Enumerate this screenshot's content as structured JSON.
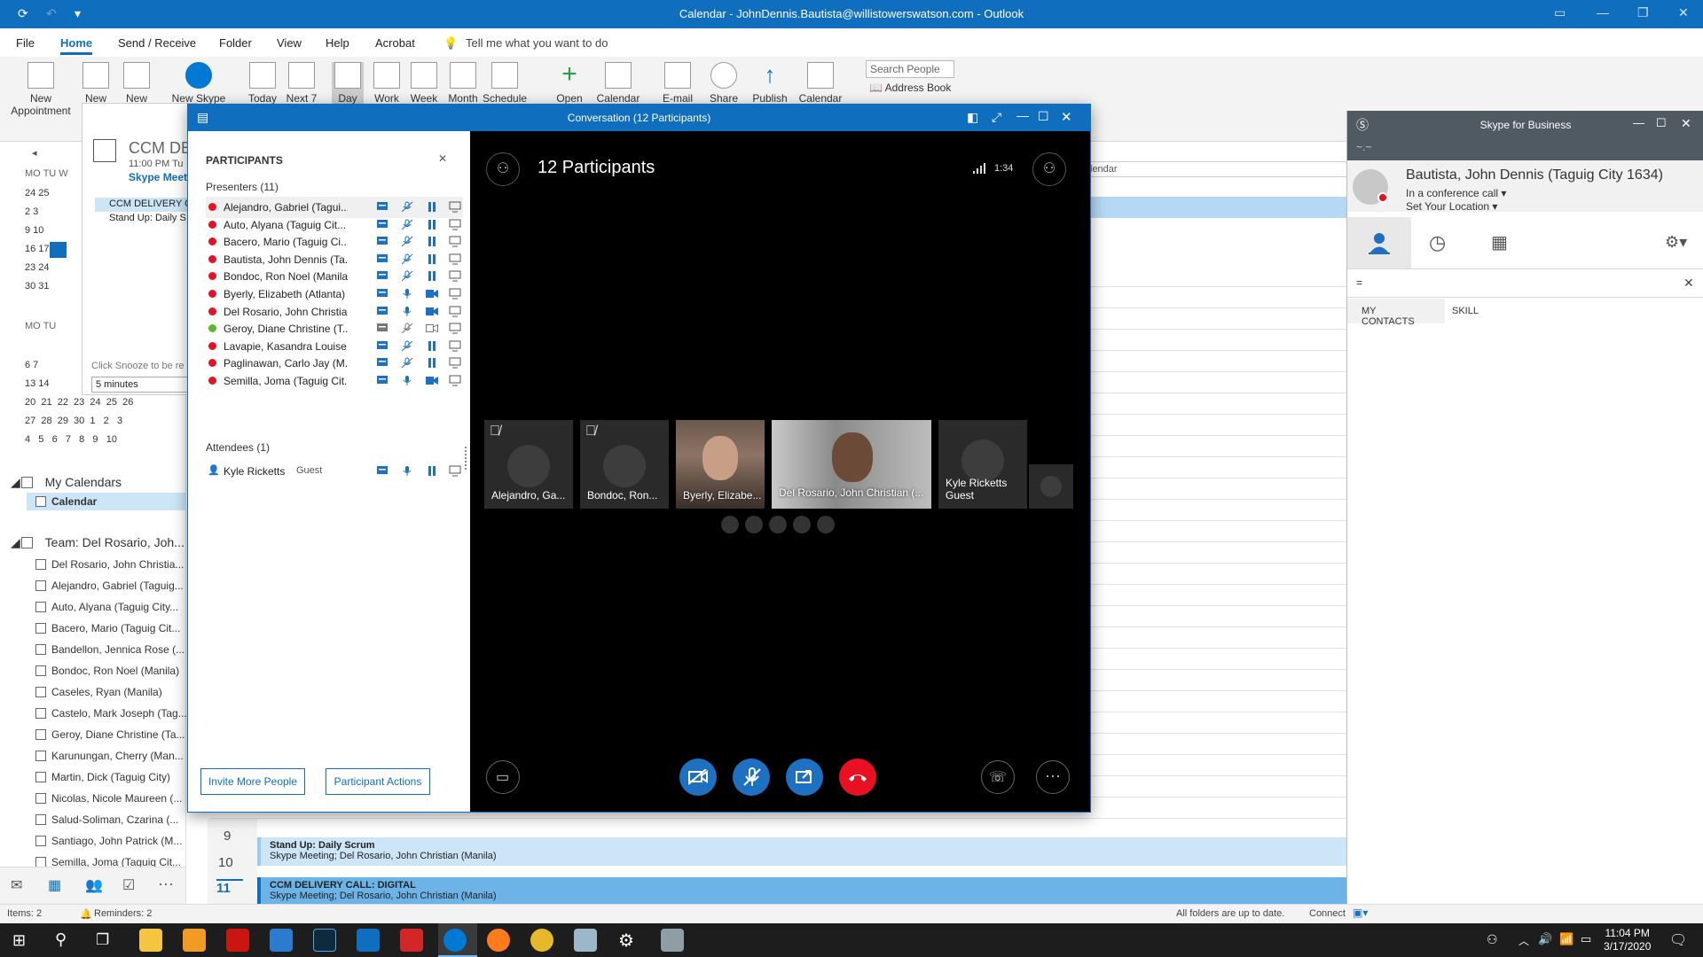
{
  "outlook": {
    "title": "Calendar - JohnDennis.Bautista@willistowerswatson.com  -  Outlook",
    "tabs": [
      "File",
      "Home",
      "Send / Receive",
      "Folder",
      "View",
      "Help",
      "Acrobat"
    ],
    "tell_me": "Tell me what you want to do",
    "ribbon": {
      "new_appointment": "New Appointment",
      "new_meeting": "New",
      "new_items": "New",
      "new_skype": "New Skype",
      "today": "Today",
      "next7": "Next 7",
      "day": "Day",
      "work": "Work",
      "week": "Week",
      "month": "Month",
      "schedule": "Schedule",
      "open": "Open",
      "calendar": "Calendar",
      "email": "E-mail",
      "share": "Share",
      "publish": "Publish",
      "calendar2": "Calendar",
      "search_people": "Search People",
      "address_book": "Address Book"
    },
    "mini_cal": {
      "days_header": "MO  TU  W",
      "rows1": [
        "24  25",
        "2   3",
        "9   10",
        "16  17",
        "23  24",
        "30  31"
      ],
      "days_header2": "MO  TU",
      "rows2": [
        "6   7",
        "13  14",
        "20  21  22  23  24  25  26",
        "27  28  29  30  1   2   3",
        "4   5   6   7   8   9   10"
      ]
    },
    "reminder": {
      "title": "CCM DE",
      "time": "11:00 PM Tu",
      "type": "Skype Meet",
      "items": [
        "CCM DELIVERY C",
        "Stand Up: Daily S"
      ],
      "snooze_hint": "Click Snooze to be re",
      "snooze_value": "5 minutes"
    },
    "my_calendars": "My Calendars",
    "calendar_item": "Calendar",
    "team_group": "Team: Del Rosario, Joh...",
    "team_members": [
      "Del Rosario, John Christia...",
      "Alejandro, Gabriel (Taguig...",
      "Auto, Alyana (Taguig City...",
      "Bacero, Mario (Taguig Cit...",
      "Bandellon, Jennica Rose (...",
      "Bondoc, Ron Noel (Manila)",
      "Caseles, Ryan (Manila)",
      "Castelo, Mark Joseph (Tag...",
      "Geroy, Diane Christine (Ta...",
      "Karunungan, Cherry (Man...",
      "Martin, Dick (Taguig City)",
      "Nicolas, Nicole Maureen (...",
      "Salud-Soliman, Czarina (...",
      "Santiago, John Patrick (M...",
      "Semilla, Joma (Taguig Cit..."
    ],
    "cal_header_fragment": "lendar",
    "hours": [
      "9",
      "10",
      "11"
    ],
    "appointments": [
      {
        "title": "Stand Up: Daily Scrum",
        "sub": "Skype Meeting; Del Rosario, John Christian (Manila)"
      },
      {
        "title": "CCM DELIVERY CALL: DIGITAL",
        "sub": "Skype Meeting; Del Rosario, John Christian (Manila)"
      }
    ],
    "status_items": "Items: 2",
    "status_reminders": "Reminders: 2",
    "status_sync": "All folders are up to date.",
    "status_connected": "Connect"
  },
  "conversation": {
    "title": "Conversation (12 Participants)",
    "participants_header": "PARTICIPANTS",
    "presenters_label": "Presenters (11)",
    "presenters": [
      {
        "name": "Alejandro, Gabriel (Tagui...",
        "status": "busy",
        "cam": "paused"
      },
      {
        "name": "Auto, Alyana (Taguig Cit...",
        "status": "busy",
        "cam": "paused"
      },
      {
        "name": "Bacero, Mario (Taguig Ci...",
        "status": "busy",
        "cam": "paused"
      },
      {
        "name": "Bautista, John Dennis (Ta...",
        "status": "busy",
        "cam": "paused"
      },
      {
        "name": "Bondoc, Ron Noel (Manila)",
        "status": "busy",
        "cam": "paused"
      },
      {
        "name": "Byerly, Elizabeth (Atlanta)",
        "status": "busy",
        "cam": "on"
      },
      {
        "name": "Del Rosario, John Christia...",
        "status": "busy",
        "cam": "on"
      },
      {
        "name": "Geroy, Diane Christine (T...",
        "status": "available",
        "cam": "off"
      },
      {
        "name": "Lavapie, Kasandra Louise...",
        "status": "busy",
        "cam": "paused"
      },
      {
        "name": "Paglinawan, Carlo Jay (M...",
        "status": "busy",
        "cam": "paused"
      },
      {
        "name": "Semilla, Joma (Taguig Cit...",
        "status": "busy",
        "cam": "on"
      }
    ],
    "attendees_label": "Attendees (1)",
    "attendee": {
      "name": "Kyle Ricketts",
      "role": "Guest"
    },
    "invite_button": "Invite More People",
    "actions_button": "Participant Actions",
    "video_header": "12 Participants",
    "duration": "1:34",
    "tiles": [
      {
        "label": "Alejandro, Ga..."
      },
      {
        "label": "Bondoc, Ron..."
      },
      {
        "label": "Byerly, Elizabe..."
      },
      {
        "label": "Del Rosario, John Christian (..."
      },
      {
        "label": "Kyle Ricketts",
        "sub": "Guest"
      }
    ]
  },
  "skype": {
    "title": "Skype for Business",
    "name": "Bautista, John Dennis (Taguig City 1634)",
    "status": "In a conference call",
    "location": "Set Your Location",
    "search_value": "=",
    "tab_contacts": "MY CONTACTS",
    "tab_skill": "SKILL"
  },
  "taskbar": {
    "time": "11:04 PM",
    "date": "3/17/2020"
  }
}
